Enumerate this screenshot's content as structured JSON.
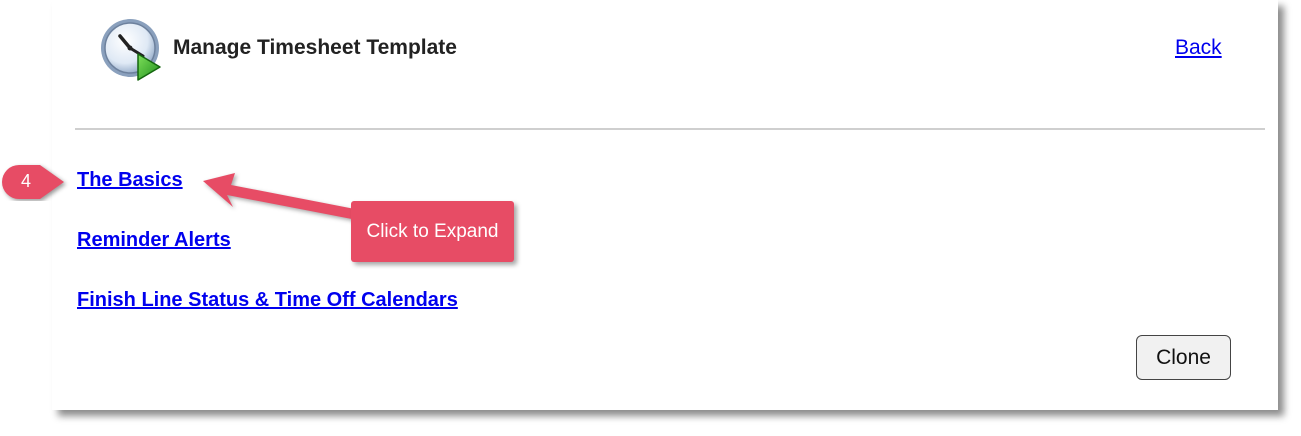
{
  "header": {
    "title": "Manage Timesheet Template",
    "back_label": "Back",
    "icon": "clock-play-icon"
  },
  "sections": [
    {
      "label": "The Basics"
    },
    {
      "label": "Reminder Alerts"
    },
    {
      "label": "Finish Line Status & Time Off Calendars"
    }
  ],
  "actions": {
    "clone_label": "Clone"
  },
  "annotation": {
    "step_number": "4",
    "callout_text": "Click to Expand",
    "color": "#e74c65"
  },
  "colors": {
    "link": "#0000ee",
    "divider": "#cfcfcf"
  }
}
